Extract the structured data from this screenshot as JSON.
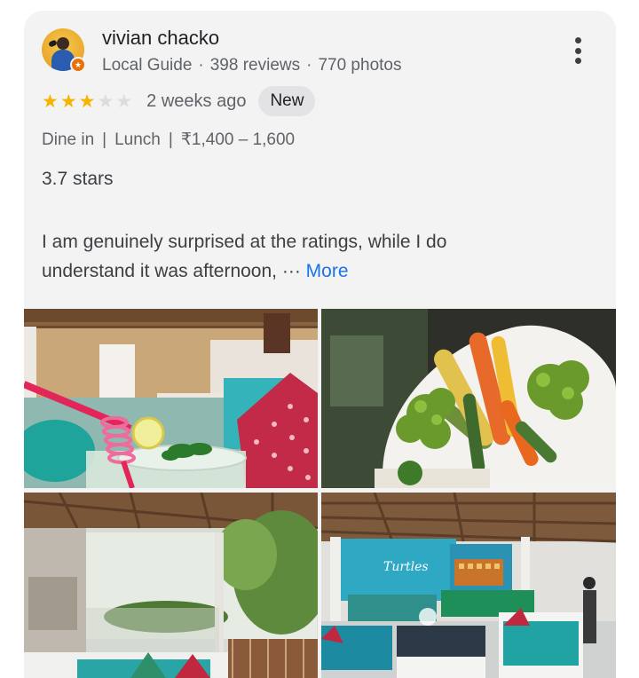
{
  "review": {
    "author": {
      "name": "vivian chacko",
      "role": "Local Guide",
      "reviews": "398 reviews",
      "photos": "770 photos",
      "meta_separator": "·"
    },
    "rating": {
      "stars_filled": 3,
      "stars_total": 5
    },
    "time": "2 weeks ago",
    "badge": "New",
    "visit": {
      "type": "Dine in",
      "meal": "Lunch",
      "price": "₹1,400 – 1,600",
      "separator": "|"
    },
    "stars_text": "3.7 stars",
    "text_line1": "I am genuinely surprised at the ratings, while I do",
    "text_line2": "understand it was afternoon, ",
    "ellipsis": "···",
    "more_label": "More",
    "menu_icon": "more-vert-icon",
    "star_color": "#f4b400",
    "link_color": "#1a73e8"
  },
  "photos": [
    {
      "name": "mojito-drink-photo"
    },
    {
      "name": "grilled-vegetables-photo"
    },
    {
      "name": "garden-seating-photo"
    },
    {
      "name": "turtles-cafe-interior-photo",
      "sign_text": "Turtles"
    }
  ]
}
